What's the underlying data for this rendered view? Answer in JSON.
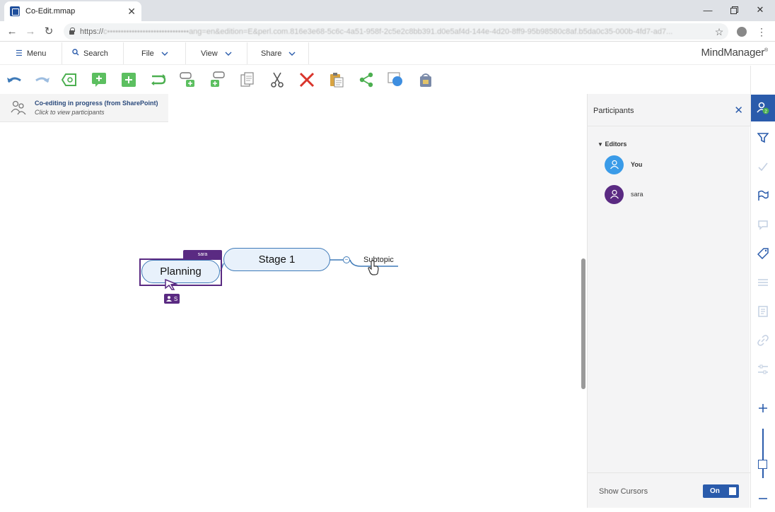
{
  "browser": {
    "tab_title": "Co-Edit.mmap",
    "url_scheme": "https://",
    "url_obscured": "c••••••••••••••••••••••••••••••ang=en&edition=E&perl.com.816e3e68-5c6c-4a51-958f-2c5e2c8bb391.d0e5af4d-144e-4d20-8ff9-95b98580c8af.b5da0c35-000b-4fd7-ad7..."
  },
  "menu": {
    "menu_label": "Menu",
    "search_label": "Search",
    "file_label": "File",
    "view_label": "View",
    "share_label": "Share",
    "brand": "MindManager",
    "brand_mark": "®"
  },
  "banner": {
    "title": "Co-editing in progress (from SharePoint)",
    "subtitle": "Click to view participants"
  },
  "map": {
    "central_topic": "Planning",
    "central_owner_tag": "sara",
    "central_user_chip": "S",
    "topic_stage": "Stage 1",
    "subtopic": "Subtopic",
    "collapse_symbol": "−"
  },
  "panel": {
    "title": "Participants",
    "editors_heading": "Editors",
    "participants": [
      {
        "name": "You",
        "color": "#3a9be8"
      },
      {
        "name": "sara",
        "color": "#5a2a82"
      }
    ],
    "show_cursors_label": "Show Cursors",
    "show_cursors_value": "On"
  },
  "colors": {
    "accent": "#2a5bab",
    "owner": "#5a2a82",
    "topic_border": "#3e7ab8",
    "toolbar_green": "#4caf50",
    "delete_red": "#d9342b"
  },
  "rail": {
    "participant_badge": "2"
  }
}
